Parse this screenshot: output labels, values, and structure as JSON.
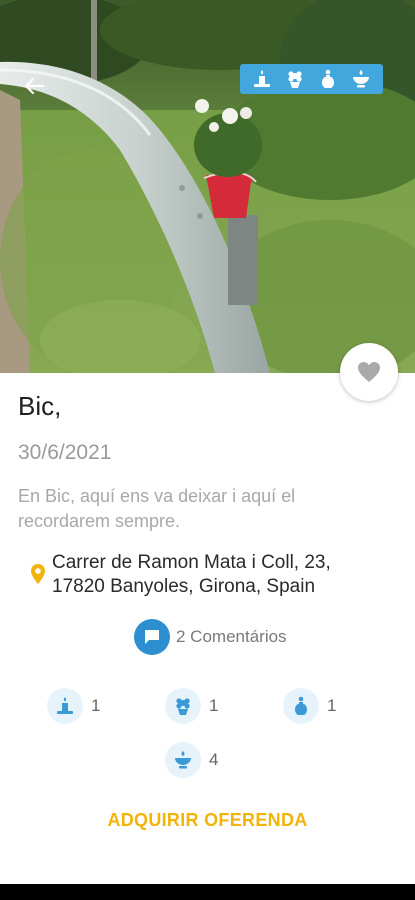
{
  "memorial": {
    "name": "Bic,",
    "date": "30/6/2021",
    "description": "En Bic, aquí ens va deixar i aquí el recordarem sempre.",
    "address": "Carrer de Ramon Mata i Coll, 23, 17820 Banyoles, Girona, Spain"
  },
  "comments": {
    "label": "2 Comentários"
  },
  "offerings": [
    {
      "icon": "candle-icon",
      "count": "1"
    },
    {
      "icon": "flower-icon",
      "count": "1"
    },
    {
      "icon": "vase-icon",
      "count": "1"
    },
    {
      "icon": "bowl-icon",
      "count": "4"
    }
  ],
  "actions": {
    "buy_offering": "ADQUIRIR OFERENDA"
  },
  "colors": {
    "accent_blue": "#42a7dc",
    "cta_yellow": "#f2b40a",
    "pin_yellow": "#f2b40a"
  }
}
